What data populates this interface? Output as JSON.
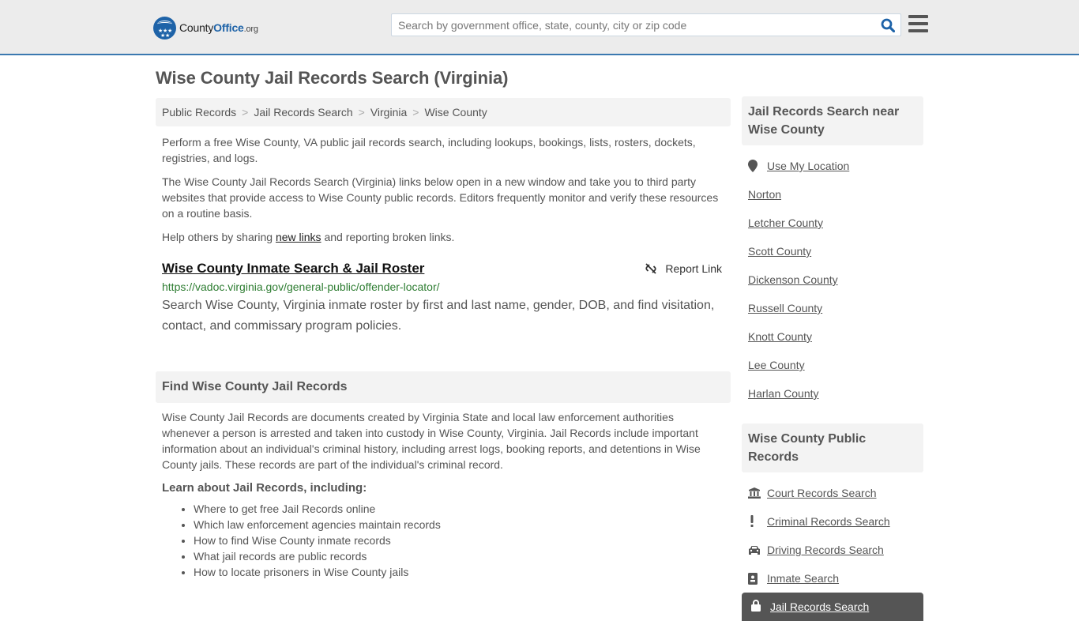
{
  "header": {
    "logo": {
      "part1": "County",
      "part2": "Office",
      "part3": ".org"
    },
    "search_placeholder": "Search by government office, state, county, city or zip code",
    "accent_color": "#1e63a8"
  },
  "page": {
    "title": "Wise County Jail Records Search (Virginia)",
    "breadcrumb": [
      "Public Records",
      "Jail Records Search",
      "Virginia",
      "Wise County"
    ],
    "intro1": "Perform a free Wise County, VA public jail records search, including lookups, bookings, lists, rosters, dockets, registries, and logs.",
    "intro2": "The Wise County Jail Records Search (Virginia) links below open in a new window and take you to third party websites that provide access to Wise County public records. Editors frequently monitor and verify these resources on a routine basis.",
    "intro3_prefix": "Help others by sharing ",
    "intro3_link": "new links",
    "intro3_suffix": " and reporting broken links.",
    "result": {
      "title": "Wise County Inmate Search & Jail Roster",
      "report_label": "Report Link",
      "url": "https://vadoc.virginia.gov/general-public/offender-locator/",
      "description": "Search Wise County, Virginia inmate roster by first and last name, gender, DOB, and find visitation, contact, and commissary program policies."
    },
    "find_section": {
      "heading": "Find Wise County Jail Records",
      "body": "Wise County Jail Records are documents created by Virginia State and local law enforcement authorities whenever a person is arrested and taken into custody in Wise County, Virginia. Jail Records include important information about an individual's criminal history, including arrest logs, booking reports, and detentions in Wise County jails. These records are part of the individual's criminal record.",
      "learn_heading": "Learn about Jail Records, including:",
      "learn_items": [
        "Where to get free Jail Records online",
        "Which law enforcement agencies maintain records",
        "How to find Wise County inmate records",
        "What jail records are public records",
        "How to locate prisoners in Wise County jails"
      ]
    }
  },
  "sidebar": {
    "nearby_heading": "Jail Records Search near Wise County",
    "use_location": "Use My Location",
    "nearby": [
      "Norton",
      "Letcher County",
      "Scott County",
      "Dickenson County",
      "Russell County",
      "Knott County",
      "Lee County",
      "Harlan County"
    ],
    "records_heading": "Wise County Public Records",
    "records": [
      {
        "label": "Court Records Search",
        "icon": "courthouse-icon"
      },
      {
        "label": "Criminal Records Search",
        "icon": "exclamation-icon"
      },
      {
        "label": "Driving Records Search",
        "icon": "car-icon"
      },
      {
        "label": "Inmate Search",
        "icon": "id-badge-icon"
      }
    ],
    "active": {
      "label": "Jail Records Search",
      "icon": "lock-icon"
    }
  }
}
